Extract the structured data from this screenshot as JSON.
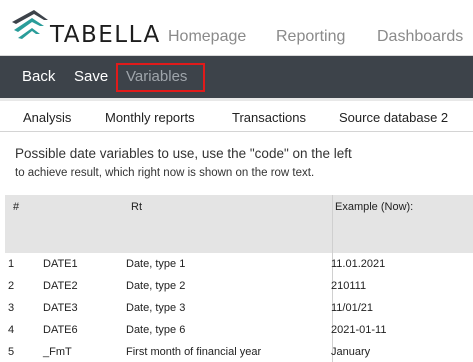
{
  "app": {
    "logo_text": "TABELLA"
  },
  "topnav": {
    "homepage": "Homepage",
    "reporting": "Reporting",
    "dashboards": "Dashboards"
  },
  "toolbar": {
    "back": "Back",
    "save": "Save",
    "variables": "Variables"
  },
  "subnav": [
    "Analysis",
    "Monthly reports",
    "Transactions",
    "Source database 2"
  ],
  "description": {
    "line1": "Possible date variables to use, use the \"code\" on the left",
    "line2": "to achieve result, which right now is shown on the row text."
  },
  "table": {
    "headers": {
      "num": "#",
      "rt": "Rt",
      "example": "Example (Now):"
    },
    "rows": [
      {
        "num": "1",
        "code": "DATE1",
        "rt": "Date, type 1",
        "example": "11.01.2021"
      },
      {
        "num": "2",
        "code": "DATE2",
        "rt": "Date, type 2",
        "example": "210111"
      },
      {
        "num": "3",
        "code": "DATE3",
        "rt": "Date, type 3",
        "example": "11/01/21"
      },
      {
        "num": "4",
        "code": "DATE6",
        "rt": "Date, type 6",
        "example": "2021-01-11"
      },
      {
        "num": "5",
        "code": "_FmT",
        "rt": "First month of financial year",
        "example": "January"
      }
    ]
  },
  "colors": {
    "toolbar_bg": "#3d434a",
    "highlight_border": "#e11a1a",
    "logo_teal": "#2a9d9a",
    "logo_dark": "#3d434a"
  }
}
